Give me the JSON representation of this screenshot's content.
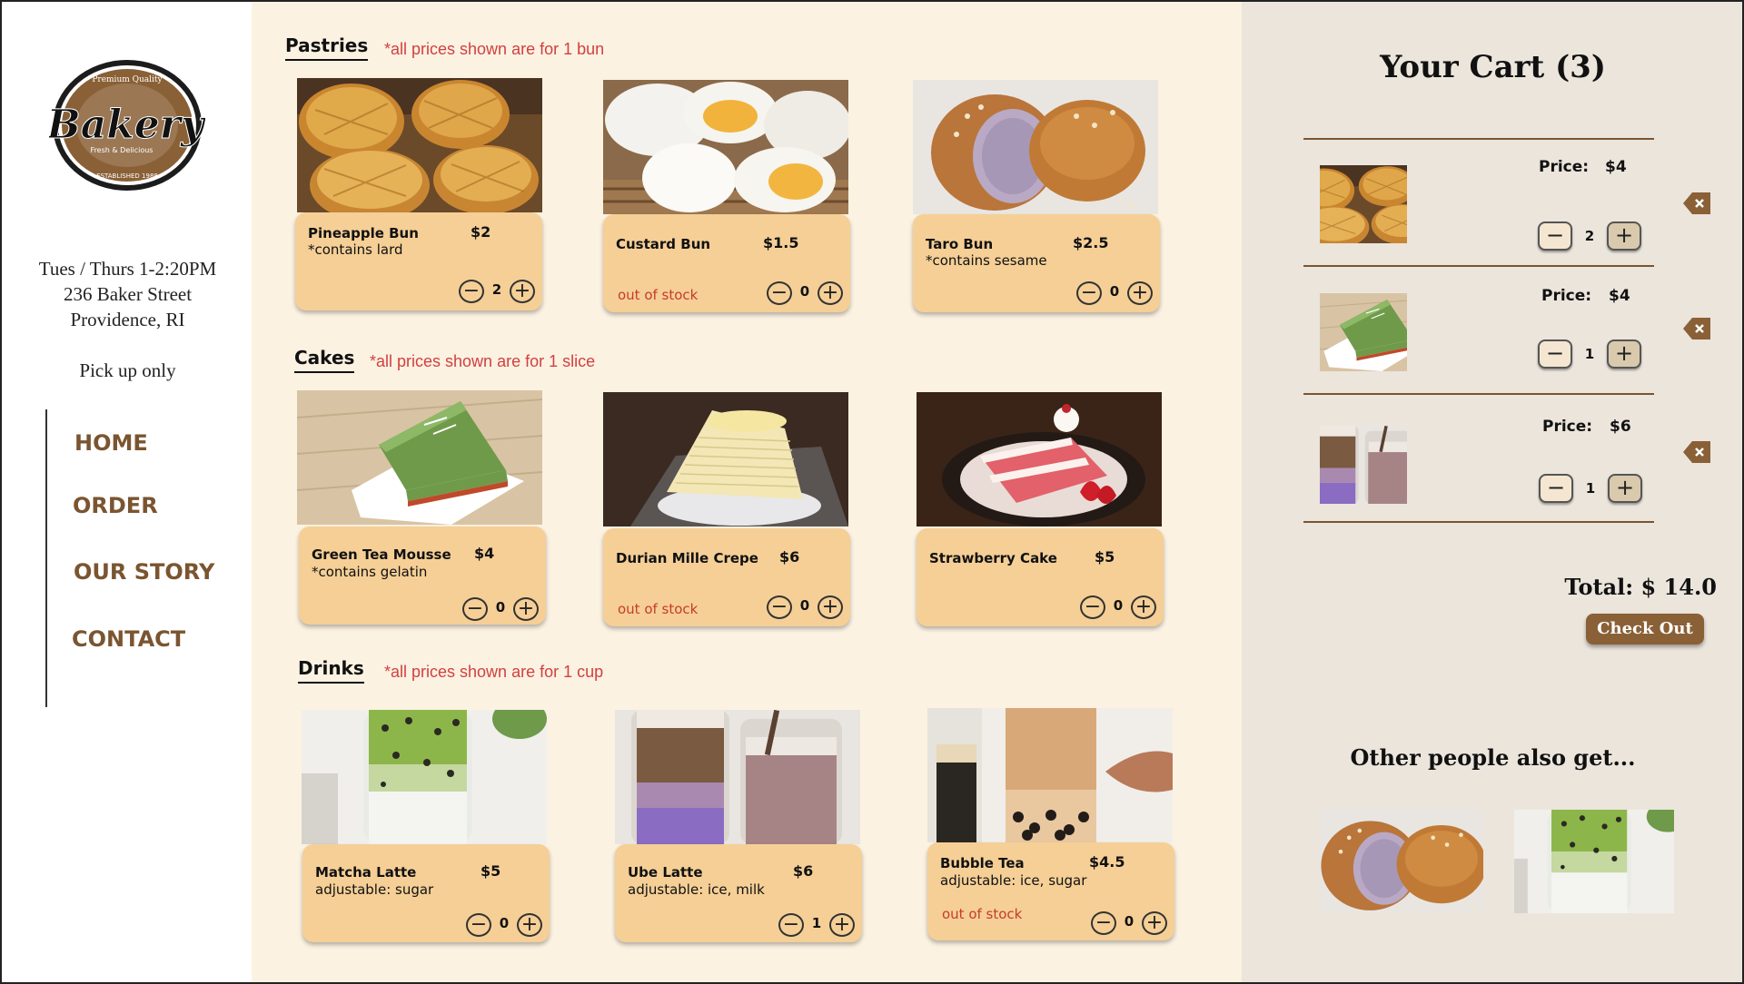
{
  "logo": {
    "top": "Premium Quality",
    "name": "Bakery",
    "middle": "Fresh & Delicious",
    "bottom": "ESTABLISHED 1988"
  },
  "info": {
    "hours": "Tues / Thurs 1-2:20PM",
    "street": "236 Baker Street",
    "city": "Providence, RI",
    "pickup": "Pick up only"
  },
  "nav": {
    "home": "HOME",
    "order": "ORDER",
    "story": "OUR STORY",
    "contact": "CONTACT"
  },
  "sections": {
    "pastries": {
      "title": "Pastries",
      "note": "*all prices shown are for 1 bun"
    },
    "cakes": {
      "title": "Cakes",
      "note": "*all prices shown are for 1 slice"
    },
    "drinks": {
      "title": "Drinks",
      "note": "*all prices shown are for 1 cup"
    }
  },
  "items": [
    {
      "name": "Pineapple Bun",
      "price": "$2",
      "note": "*contains lard",
      "status": "",
      "qty": "2"
    },
    {
      "name": "Custard Bun",
      "price": "$1.5",
      "note": "",
      "status": "out of stock",
      "qty": "0"
    },
    {
      "name": "Taro Bun",
      "price": "$2.5",
      "note": "*contains sesame",
      "status": "",
      "qty": "0"
    },
    {
      "name": "Green Tea Mousse",
      "price": "$4",
      "note": "*contains gelatin",
      "status": "",
      "qty": "0"
    },
    {
      "name": "Durian Mille Crepe",
      "price": "$6",
      "note": "",
      "status": "out of stock",
      "qty": "0"
    },
    {
      "name": "Strawberry Cake",
      "price": "$5",
      "note": "",
      "status": "",
      "qty": "0"
    },
    {
      "name": "Matcha Latte",
      "price": "$5",
      "note": "adjustable: sugar",
      "status": "",
      "qty": "0"
    },
    {
      "name": "Ube Latte",
      "price": "$6",
      "note": "adjustable: ice, milk",
      "status": "",
      "qty": "1"
    },
    {
      "name": "Bubble Tea",
      "price": "$4.5",
      "note": "adjustable: ice, sugar",
      "status": "out of stock",
      "qty": "0"
    }
  ],
  "cart": {
    "title": "Your Cart (3)",
    "price_label": "Price:",
    "items": [
      {
        "price": "$4",
        "qty": "2"
      },
      {
        "price": "$4",
        "qty": "1"
      },
      {
        "price": "$6",
        "qty": "1"
      }
    ],
    "total": "Total: $ 14.0",
    "checkout": "Check Out",
    "also_title": "Other people also get..."
  },
  "colors": {
    "brown": "#7a5530",
    "card": "#f5cf96",
    "main_bg": "#fbf2e2",
    "cart_bg": "#ebe5dc",
    "out_of_stock": "#c63c2a",
    "note_red": "#d24040"
  }
}
